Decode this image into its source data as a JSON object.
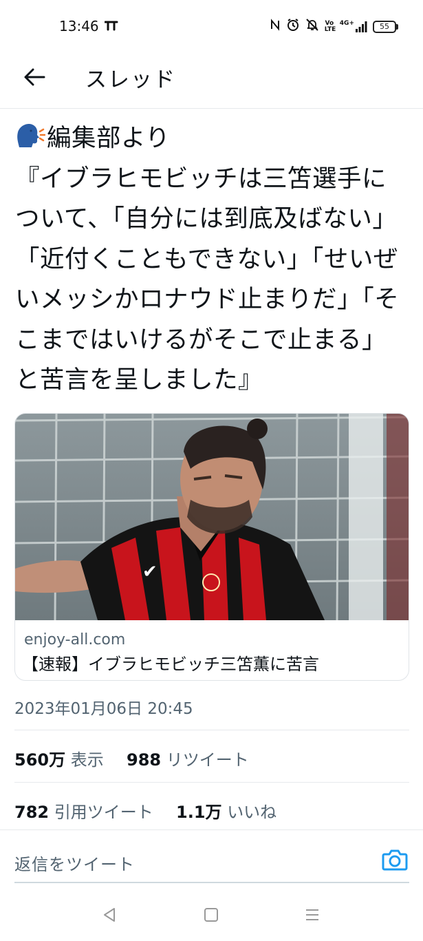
{
  "status_bar": {
    "time": "13:46",
    "left_icon": "tt-notification-icon",
    "right_icons": [
      "nfc-icon",
      "alarm-icon",
      "mute-icon",
      "volte-icon",
      "4g-signal-icon",
      "battery-icon"
    ],
    "volte_text": "Vo LTE",
    "network_text": "4G+",
    "battery_level": "55"
  },
  "header": {
    "title": "スレッド",
    "back_icon": "arrow-left-icon"
  },
  "tweet": {
    "emoji": "speaking-head-emoji",
    "text": "編集部より\n『イブラヒモビッチは三笘選手について、「自分には到底及ばない」「近付くこともできない」「せいぜいメッシかロナウド止まりだ」「そこまではいけるがそこで止まる」と苦言を呈しました』",
    "timestamp": "2023年01月06日 20:45"
  },
  "card": {
    "image": "football-player-photo",
    "domain": "enjoy-all.com",
    "title": "【速報】イブラヒモビッチ三笘薫に苦言"
  },
  "stats": {
    "views_count": "560万",
    "views_label": "表示",
    "retweets_count": "988",
    "retweets_label": "リツイート",
    "quotes_count": "782",
    "quotes_label": "引用ツイート",
    "likes_count": "1.1万",
    "likes_label": "いいね"
  },
  "reply": {
    "placeholder": "返信をツイート",
    "camera_icon": "camera-icon",
    "accent_color": "#1d9bf0"
  },
  "nav_bar": {
    "buttons": [
      "back-triangle-icon",
      "home-square-icon",
      "menu-lines-icon"
    ]
  }
}
